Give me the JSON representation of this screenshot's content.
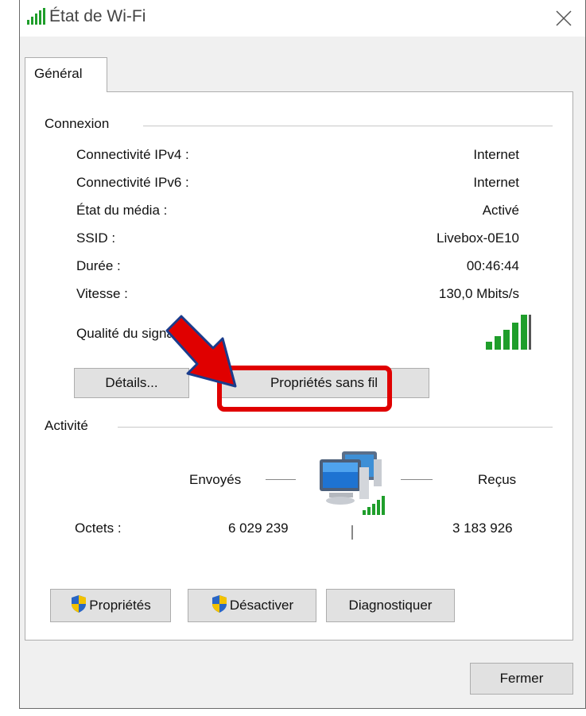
{
  "window": {
    "title": "État de Wi-Fi",
    "close_glyph": "✕"
  },
  "tabs": [
    "Général"
  ],
  "connexion": {
    "section_label": "Connexion",
    "rows": [
      {
        "label": "Connectivité IPv4 :",
        "value": "Internet"
      },
      {
        "label": "Connectivité IPv6 :",
        "value": "Internet"
      },
      {
        "label": "État du média :",
        "value": "Activé"
      },
      {
        "label": "SSID :",
        "value": "Livebox-0E10"
      },
      {
        "label": "Durée :",
        "value": "00:46:44"
      },
      {
        "label": "Vitesse :",
        "value": "130,0 Mbits/s"
      }
    ],
    "signal_label": "Qualité du signal :",
    "signal_bars": 5,
    "details_button": "Détails...",
    "wireless_props_button": "Propriétés sans fil"
  },
  "activite": {
    "section_label": "Activité",
    "sent_label": "Envoyés",
    "received_label": "Reçus",
    "bytes_label": "Octets :",
    "bytes_sent": "6 029 239",
    "bytes_received": "3 183 926"
  },
  "actions": {
    "properties_button": "Propriétés",
    "disable_button": "Désactiver",
    "diagnose_button": "Diagnostiquer"
  },
  "footer": {
    "close_button": "Fermer"
  },
  "icons": {
    "title": "wifi-signal-icon",
    "signal": "signal-bars-icon",
    "network": "network-computers-icon",
    "shield": "uac-shield-icon",
    "annotation_arrow": "red-arrow-annotation",
    "annotation_box": "red-highlight-box"
  },
  "colors": {
    "annotation_red": "#e00000",
    "signal_green": "#1f9e2b",
    "window_bg": "#f0f0f0",
    "button_bg": "#e1e1e1"
  }
}
